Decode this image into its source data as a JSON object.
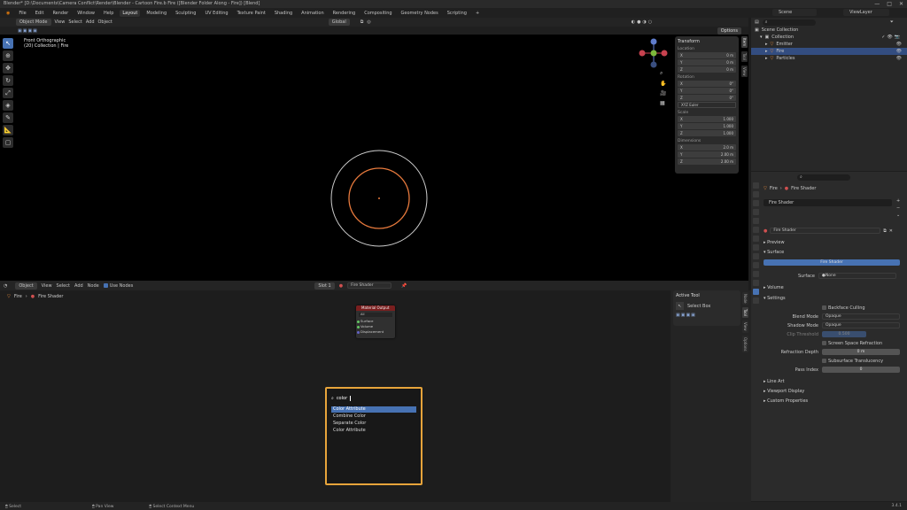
{
  "titlebar": {
    "title": "Blender* [D:\\Documents\\Camera Conflict\\Render\\Blender - Cartoon Fire.b Fire ([Blender Folder Along - Fire]) [Blend]",
    "controls": [
      "—",
      "□",
      "✕"
    ]
  },
  "menubar": {
    "items": [
      "File",
      "Edit",
      "Render",
      "Window",
      "Help"
    ],
    "workspaces": [
      "Layout",
      "Modeling",
      "Sculpting",
      "UV Editing",
      "Texture Paint",
      "Shading",
      "Animation",
      "Rendering",
      "Compositing",
      "Geometry Nodes",
      "Scripting",
      "+"
    ],
    "active_workspace": "Layout",
    "scene_label": "Scene",
    "view_layer_label": "ViewLayer"
  },
  "viewport": {
    "mode": "Object Mode",
    "menus": [
      "View",
      "Select",
      "Add",
      "Object"
    ],
    "orientation": "Global",
    "options": "Options",
    "label_line1": "Front Orthographic",
    "label_line2": "(20) Collection | Fire"
  },
  "npanel": {
    "header": "Transform",
    "location_label": "Location",
    "location": [
      [
        "X",
        "0 m"
      ],
      [
        "Y",
        "0 m"
      ],
      [
        "Z",
        "0 m"
      ]
    ],
    "rotation_label": "Rotation",
    "rotation": [
      [
        "X",
        "0°"
      ],
      [
        "Y",
        "0°"
      ],
      [
        "Z",
        "0°"
      ]
    ],
    "rotation_mode": "XYZ Euler",
    "scale_label": "Scale",
    "scale": [
      [
        "X",
        "1.000"
      ],
      [
        "Y",
        "1.000"
      ],
      [
        "Z",
        "1.000"
      ]
    ],
    "dimensions_label": "Dimensions",
    "dimensions": [
      [
        "X",
        "2.0 m"
      ],
      [
        "Y",
        "2.00 m"
      ],
      [
        "Z",
        "2.00 m"
      ]
    ],
    "tabs": [
      "Item",
      "Tool",
      "View"
    ]
  },
  "outliner": {
    "search_placeholder": "",
    "root": "Scene Collection",
    "collection": "Collection",
    "objects": [
      "Emitter",
      "Fire",
      "Particles"
    ],
    "selected": "Fire"
  },
  "properties": {
    "object_name": "Fire",
    "material_name": "Fire Shader",
    "slot_name": "Fire Shader",
    "sections": {
      "preview": "Preview",
      "surface": "Surface",
      "volume": "Volume",
      "settings": "Settings",
      "line_art": "Line Art",
      "viewport_display": "Viewport Display",
      "custom_properties": "Custom Properties"
    },
    "surface_shader": "Fire Shader",
    "surface_label": "Surface",
    "surface_value": "None",
    "backface_culling": "Backface Culling",
    "blend_mode_label": "Blend Mode",
    "blend_mode": "Opaque",
    "shadow_mode_label": "Shadow Mode",
    "shadow_mode": "Opaque",
    "clip_threshold_label": "Clip Threshold",
    "clip_threshold": "0.500",
    "screen_space_refraction": "Screen Space Refraction",
    "refraction_depth_label": "Refraction Depth",
    "refraction_depth": "0 m",
    "subsurface_translucency": "Subsurface Translucency",
    "pass_index_label": "Pass Index",
    "pass_index": "0"
  },
  "node_editor": {
    "mode": "Object",
    "menus": [
      "View",
      "Select",
      "Add",
      "Node"
    ],
    "use_nodes": "Use Nodes",
    "slot": "Slot 1",
    "material": "Fire Shader",
    "breadcrumb_object": "Fire",
    "breadcrumb_material": "Fire Shader",
    "node": {
      "title": "Material Output",
      "dropdown": "All",
      "sockets": [
        "Surface",
        "Volume",
        "Displacement"
      ]
    },
    "side_panel": {
      "header": "Active Tool",
      "tool": "Select Box"
    },
    "side_tabs": [
      "Node",
      "Tool",
      "View",
      "Options"
    ]
  },
  "search_popup": {
    "query": "color",
    "results": [
      "Color Attribute",
      "Combine Color",
      "Separate Color",
      "Color Attribute"
    ],
    "active_index": 0
  },
  "statusbar": {
    "left": "Select",
    "middle": "Pan View",
    "right": "Select Context Menu",
    "version": "3.4.1"
  },
  "colors": {
    "outer_ring": "#cfcfcf",
    "inner_ring": "#e87a3d",
    "search_border": "#e7a43b",
    "accent": "#4772b3",
    "node_header": "#7a1f1f"
  }
}
